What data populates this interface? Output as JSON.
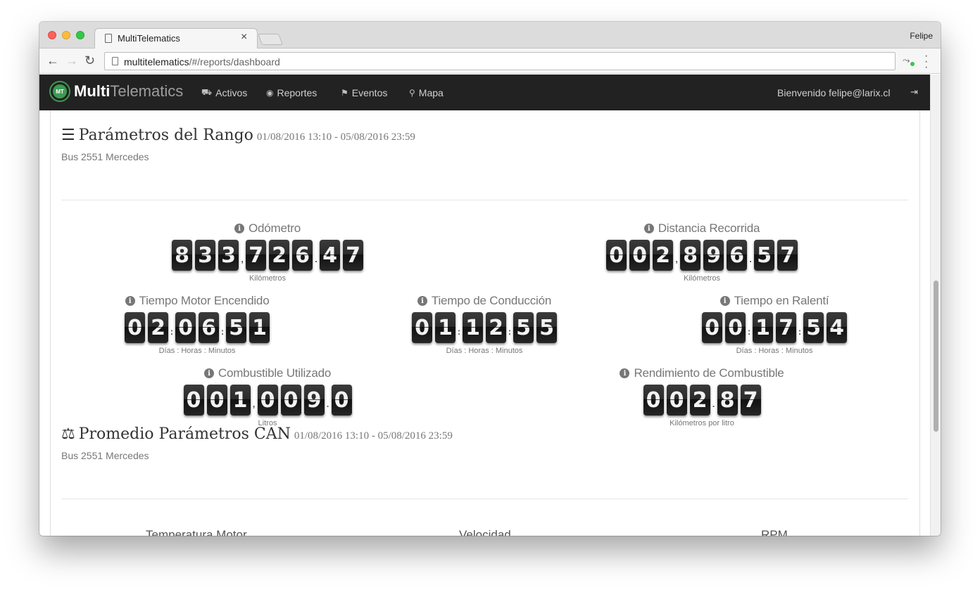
{
  "browser": {
    "tab_title": "MultiTelematics",
    "profile": "Felipe",
    "url_host": "multitelematics",
    "url_path": "/#/reports/dashboard"
  },
  "navbar": {
    "brand_bold": "Multi",
    "brand_light": "Telematics",
    "logo_text": "MT",
    "items": [
      {
        "label": "Activos",
        "icon": "car-icon"
      },
      {
        "label": "Reportes",
        "icon": "dashboard-icon"
      },
      {
        "label": "Eventos",
        "icon": "flag-icon"
      },
      {
        "label": "Mapa",
        "icon": "map-marker-icon"
      }
    ],
    "welcome": "Bienvenido felipe@larix.cl"
  },
  "range_section": {
    "title": "Parámetros del Rango",
    "date_range": "01/08/2016 13:10 - 05/08/2016 23:59",
    "vehicle": "Bus 2551 Mercedes",
    "metrics": {
      "odometro": {
        "label": "Odómetro",
        "unit": "Kilómetros",
        "groups": [
          "833",
          "726",
          "47"
        ],
        "seps": [
          ",",
          "."
        ]
      },
      "distancia": {
        "label": "Distancia Recorrida",
        "unit": "Kilómetros",
        "groups": [
          "002",
          "896",
          "57"
        ],
        "seps": [
          ",",
          "."
        ]
      },
      "motor": {
        "label": "Tiempo Motor Encendido",
        "unit": "Días : Horas : Minutos",
        "groups": [
          "02",
          "06",
          "51"
        ],
        "seps": [
          ":",
          ":"
        ]
      },
      "conduccion": {
        "label": "Tiempo de Conducción",
        "unit": "Días : Horas : Minutos",
        "groups": [
          "01",
          "12",
          "55"
        ],
        "seps": [
          ":",
          ":"
        ]
      },
      "ralenti": {
        "label": "Tiempo en Ralentí",
        "unit": "Días : Horas : Minutos",
        "groups": [
          "00",
          "17",
          "54"
        ],
        "seps": [
          ":",
          ":"
        ]
      },
      "combustible": {
        "label": "Combustible Utilizado",
        "unit": "Litros",
        "groups": [
          "001",
          "009",
          "0"
        ],
        "seps": [
          ",",
          "."
        ]
      },
      "rendimiento": {
        "label": "Rendimiento de Combustible",
        "unit": "Kilómetros por litro",
        "groups": [
          "002",
          "87"
        ],
        "seps": [
          "."
        ]
      }
    }
  },
  "can_section": {
    "title": "Promedio Parámetros CAN",
    "date_range": "01/08/2016 13:10 - 05/08/2016 23:59",
    "vehicle": "Bus 2551 Mercedes",
    "columns": [
      "Temperatura Motor",
      "Velocidad",
      "RPM"
    ]
  }
}
